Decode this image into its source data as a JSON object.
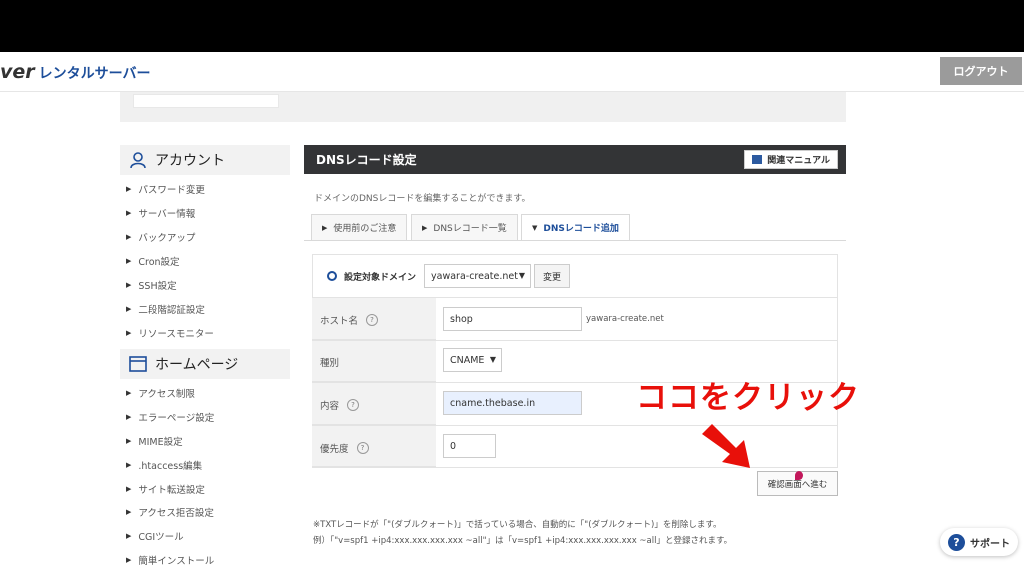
{
  "header": {
    "logo_strong": "ver",
    "logo_sub": "レンタルサーバー",
    "logout_label": "ログアウト"
  },
  "sidebar": {
    "account_title": "アカウント",
    "account_items": [
      "パスワード変更",
      "サーバー情報",
      "バックアップ",
      "Cron設定",
      "SSH設定",
      "二段階認証設定",
      "リソースモニター"
    ],
    "homepage_title": "ホームページ",
    "homepage_items": [
      "アクセス制限",
      "エラーページ設定",
      "MIME設定",
      ".htaccess編集",
      "サイト転送設定",
      "アクセス拒否設定",
      "CGIツール",
      "簡単インストール"
    ]
  },
  "panel": {
    "title": "DNSレコード設定",
    "manual_label": "関連マニュアル",
    "description": "ドメインのDNSレコードを編集することができます。",
    "tabs": [
      "使用前のご注意",
      "DNSレコード一覧",
      "DNSレコード追加"
    ]
  },
  "form": {
    "domain_label": "設定対象ドメイン",
    "domain_value": "yawara-create.net",
    "change_label": "変更",
    "host_label": "ホスト名",
    "host_value": "shop",
    "host_suffix": "yawara-create.net",
    "type_label": "種別",
    "type_value": "CNAME",
    "content_label": "内容",
    "content_value": "cname.thebase.in",
    "priority_label": "優先度",
    "priority_value": "0",
    "help_glyph": "?",
    "confirm_label": "確認画面へ進む"
  },
  "annotation": {
    "text": "ココをクリック",
    "color": "#e8100a"
  },
  "notes": [
    "※TXTレコードが「\"(ダブルクォート)」で括っている場合、自動的に「\"(ダブルクォート)」を削除します。",
    "例）「\"v=spf1 +ip4:xxx.xxx.xxx.xxx ~all\"」は「v=spf1 +ip4:xxx.xxx.xxx.xxx ~all」と登録されます。"
  ],
  "support": {
    "label": "サポート",
    "icon_glyph": "?"
  },
  "colors": {
    "accent": "#1d4e9a",
    "panel_header": "#333436",
    "logout_bg": "#9b9b9b"
  }
}
